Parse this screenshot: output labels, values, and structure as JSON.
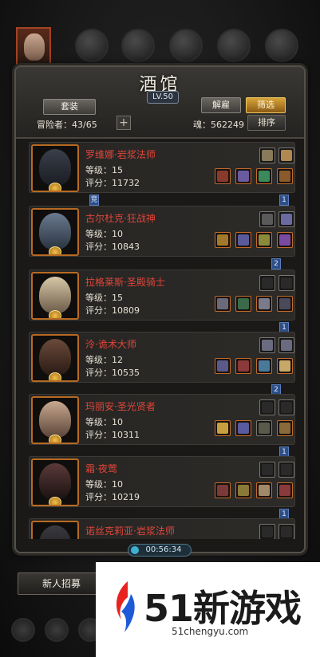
{
  "header": {
    "title": "酒馆",
    "level": "LV.50",
    "outfit_label": "套装",
    "dismiss_label": "解雇",
    "filter_label": "筛选",
    "sort_label": "排序",
    "adventurer_label": "冒险者：43/65",
    "soul_label": "魂：562249"
  },
  "heroes": [
    {
      "name": "罗维娜·岩浆法师",
      "level": "等级：15",
      "score": "评分：11732",
      "avatar_color": "#3a3f4a"
    },
    {
      "name": "古尔杜克·狂战神",
      "level": "等级：10",
      "score": "评分：10843",
      "avatar_color": "#6a7a90"
    },
    {
      "name": "拉格莱斯·圣殿骑士",
      "level": "等级：15",
      "score": "评分：10809",
      "avatar_color": "#c8b898"
    },
    {
      "name": "泠·诡术大师",
      "level": "等级：12",
      "score": "评分：10535",
      "avatar_color": "#5a3a2a"
    },
    {
      "name": "玛丽安·圣光贤者",
      "level": "等级：10",
      "score": "评分：10311",
      "avatar_color": "#a88a76"
    },
    {
      "name": "霜·夜莺",
      "level": "等级：10",
      "score": "评分：10219",
      "avatar_color": "#4a3432"
    },
    {
      "name": "诺丝克莉亚·岩浆法师",
      "level": "",
      "score": "",
      "avatar_color": "#3a3a40"
    }
  ],
  "tags": [
    "竞",
    "1",
    "2",
    "1",
    "2",
    "1",
    "1"
  ],
  "timer": "00:56:34",
  "recruit_label": "新人招募",
  "watermark": {
    "brand": "51新游戏",
    "url": "51chengyu.com"
  }
}
